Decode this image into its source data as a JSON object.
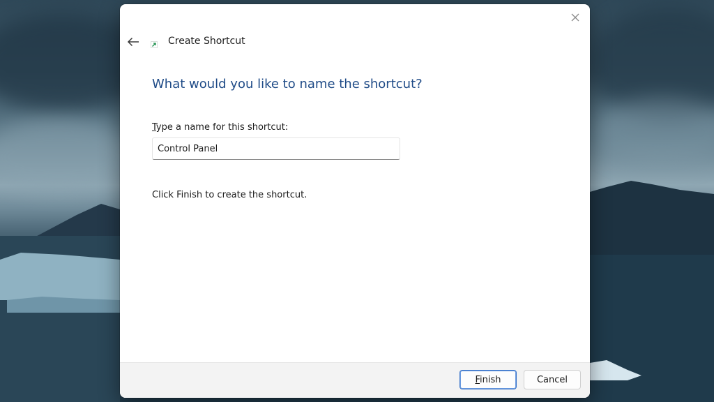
{
  "dialog": {
    "title": "Create Shortcut",
    "heading": "What would you like to name the shortcut?",
    "name_label_first": "T",
    "name_label_rest": "ype a name for this shortcut:",
    "name_value": "Control Panel",
    "finish_message": "Click Finish to create the shortcut.",
    "buttons": {
      "finish_first": "F",
      "finish_rest": "inish",
      "cancel": "Cancel"
    },
    "accent_color": "#1f4b87"
  },
  "icons": {
    "close": "close-icon",
    "back": "back-arrow-icon",
    "shortcut": "shortcut-arrow-icon"
  }
}
